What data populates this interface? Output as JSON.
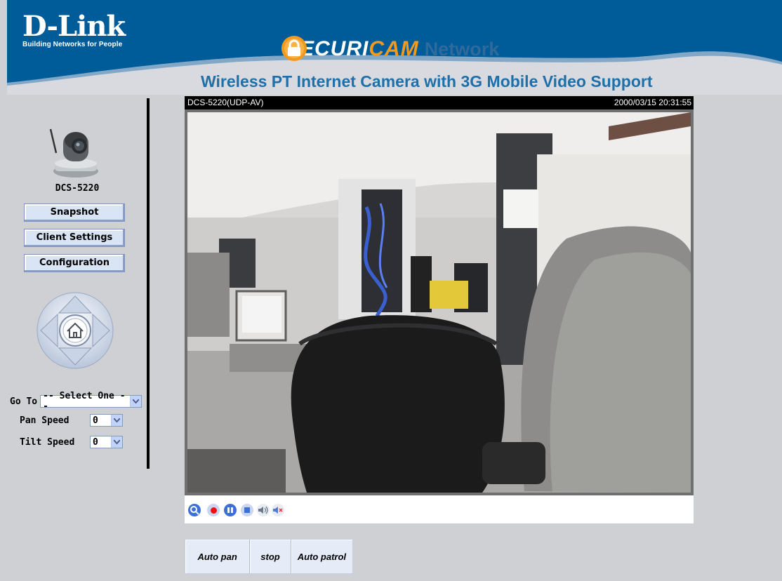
{
  "header": {
    "logo_main": "D-Link",
    "logo_tagline": "Building Networks for People",
    "brand_securi": "SECURI",
    "brand_cam": "CAM",
    "brand_network": "Network",
    "subtitle": "Wireless PT Internet Camera with 3G Mobile Video Support"
  },
  "sidebar": {
    "model": "DCS-5220",
    "buttons": [
      "Snapshot",
      "Client Settings",
      "Configuration"
    ],
    "goto_label": "Go To",
    "goto_value": "-- Select One --",
    "pan_label": "Pan Speed",
    "pan_value": "0",
    "tilt_label": "Tilt Speed",
    "tilt_value": "0"
  },
  "video": {
    "stream_name": "DCS-5220(UDP-AV)",
    "timestamp": "2000/03/15 20:31:55"
  },
  "controls": {
    "icons": [
      "zoom-in-icon",
      "record-icon",
      "pause-icon",
      "stop-icon",
      "speaker-icon",
      "mute-icon"
    ]
  },
  "patrol": {
    "buttons": [
      "Auto pan",
      "stop",
      "Auto patrol"
    ]
  },
  "colors": {
    "header_blue": "#005b99",
    "accent_orange": "#f39a1e",
    "subtitle_blue": "#1f6fa8",
    "button_bg": "#d9e4f5"
  }
}
